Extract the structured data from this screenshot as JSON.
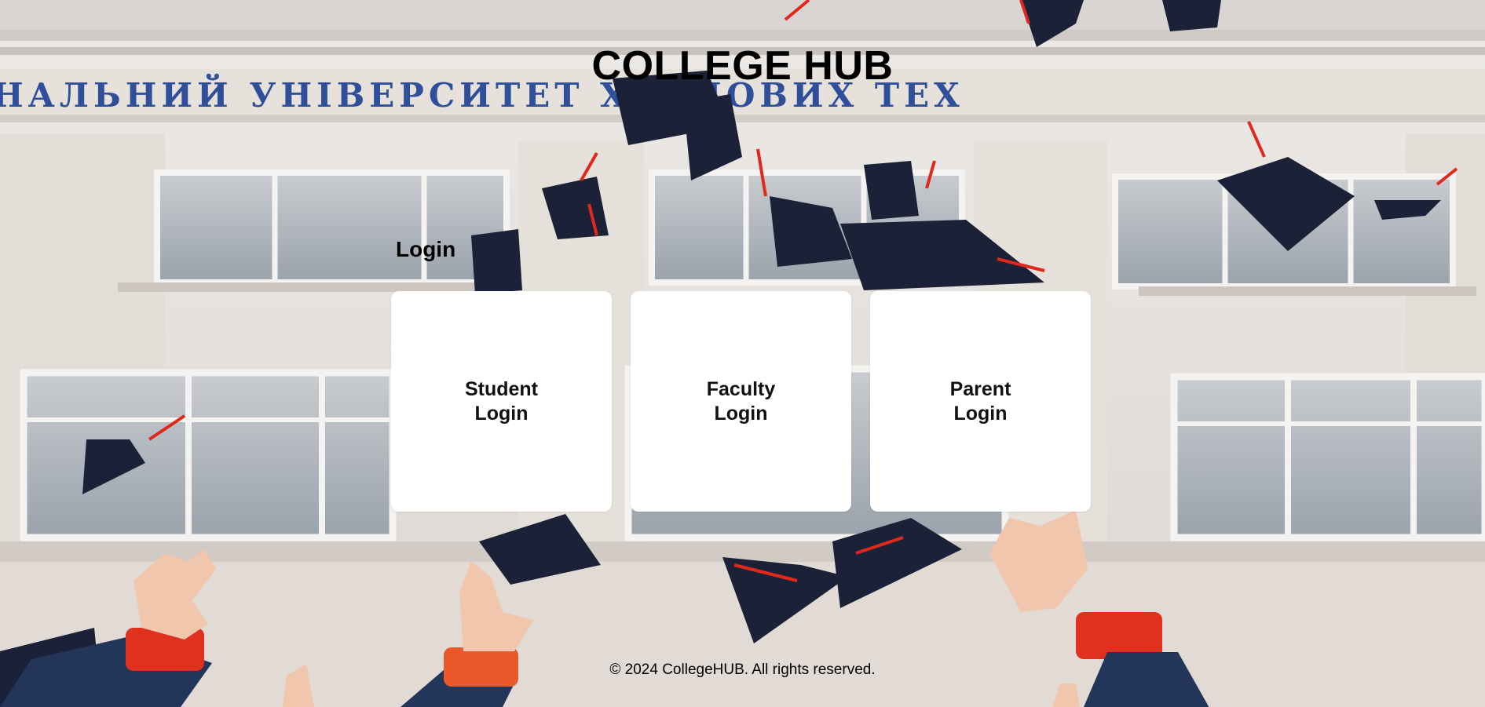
{
  "header": {
    "title": "COLLEGE HUB"
  },
  "banner_text": "НАЛЬНИЙ УНІВЕРСИТЕТ ХАРЧОВИХ ТЕХ",
  "login_section": {
    "heading": "Login",
    "cards": [
      {
        "label": "Student Login"
      },
      {
        "label": "Faculty Login"
      },
      {
        "label": "Parent Login"
      }
    ]
  },
  "footer": {
    "text": "© 2024 CollegeHUB. All rights reserved."
  },
  "colors": {
    "card_background": "#ffffff",
    "text": "#000000",
    "banner_letters": "#2f4f9a",
    "cap": "#1b2238",
    "tassel": "#e0281b"
  }
}
